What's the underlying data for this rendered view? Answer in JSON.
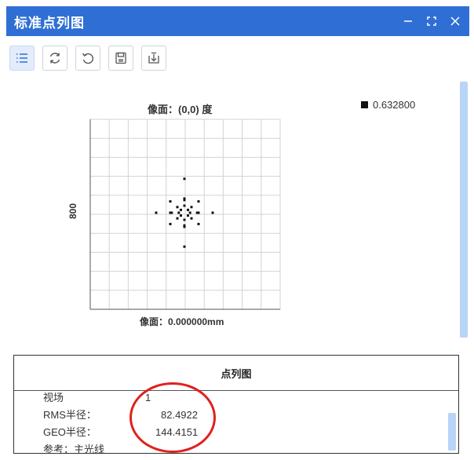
{
  "window": {
    "title": "标准点列图",
    "controls": [
      "minimize-icon",
      "fullscreen-icon",
      "close-icon"
    ]
  },
  "toolbar": {
    "buttons": [
      {
        "name": "list-icon",
        "active": true
      },
      {
        "name": "refresh-icon",
        "active": false
      },
      {
        "name": "undo-icon",
        "active": false
      },
      {
        "name": "save-icon",
        "active": false
      },
      {
        "name": "download-icon",
        "active": false
      }
    ]
  },
  "plot": {
    "title": "像面：(0,0) 度",
    "xlabel": "像面：0.000000mm",
    "ylabel": "800",
    "legend": {
      "label": "0.632800",
      "color": "#111111"
    }
  },
  "chart_data": {
    "type": "scatter",
    "title": "像面：(0,0) 度",
    "xlabel": "像面：0.000000mm",
    "ylabel": "800",
    "grid": true,
    "legend_position": "top-right",
    "series": [
      {
        "name": "0.632800",
        "color": "#111111",
        "points": [
          [
            0,
            2.4
          ],
          [
            0,
            1.0
          ],
          [
            0,
            0.9
          ],
          [
            -1.0,
            0.8
          ],
          [
            1.0,
            0.8
          ],
          [
            -0.5,
            0.4
          ],
          [
            0.5,
            0.4
          ],
          [
            0,
            0.5
          ],
          [
            -2.0,
            0
          ],
          [
            -1.0,
            0
          ],
          [
            -0.9,
            0
          ],
          [
            -0.4,
            0
          ],
          [
            0.4,
            0
          ],
          [
            0.9,
            0
          ],
          [
            1.0,
            0
          ],
          [
            2.0,
            0
          ],
          [
            -0.5,
            -0.4
          ],
          [
            0.5,
            -0.4
          ],
          [
            0,
            -0.5
          ],
          [
            -1.0,
            -0.8
          ],
          [
            1.0,
            -0.8
          ],
          [
            0,
            -0.9
          ],
          [
            0,
            -1.0
          ],
          [
            0,
            -2.4
          ],
          [
            -0.25,
            0.2
          ],
          [
            0.25,
            0.2
          ],
          [
            -0.25,
            -0.2
          ],
          [
            0.25,
            -0.2
          ]
        ]
      }
    ]
  },
  "table": {
    "title": "点列图",
    "rows": [
      {
        "key": "视场",
        "value": "1"
      },
      {
        "key": "RMS半径：",
        "value": "82.4922"
      },
      {
        "key": "GEO半径：",
        "value": "144.4151"
      },
      {
        "key": "参考：主光线",
        "value": ""
      }
    ]
  },
  "colors": {
    "titlebar": "#2f6fd5",
    "scroll": "#b8d4f7",
    "annotation": "#e0201c"
  }
}
